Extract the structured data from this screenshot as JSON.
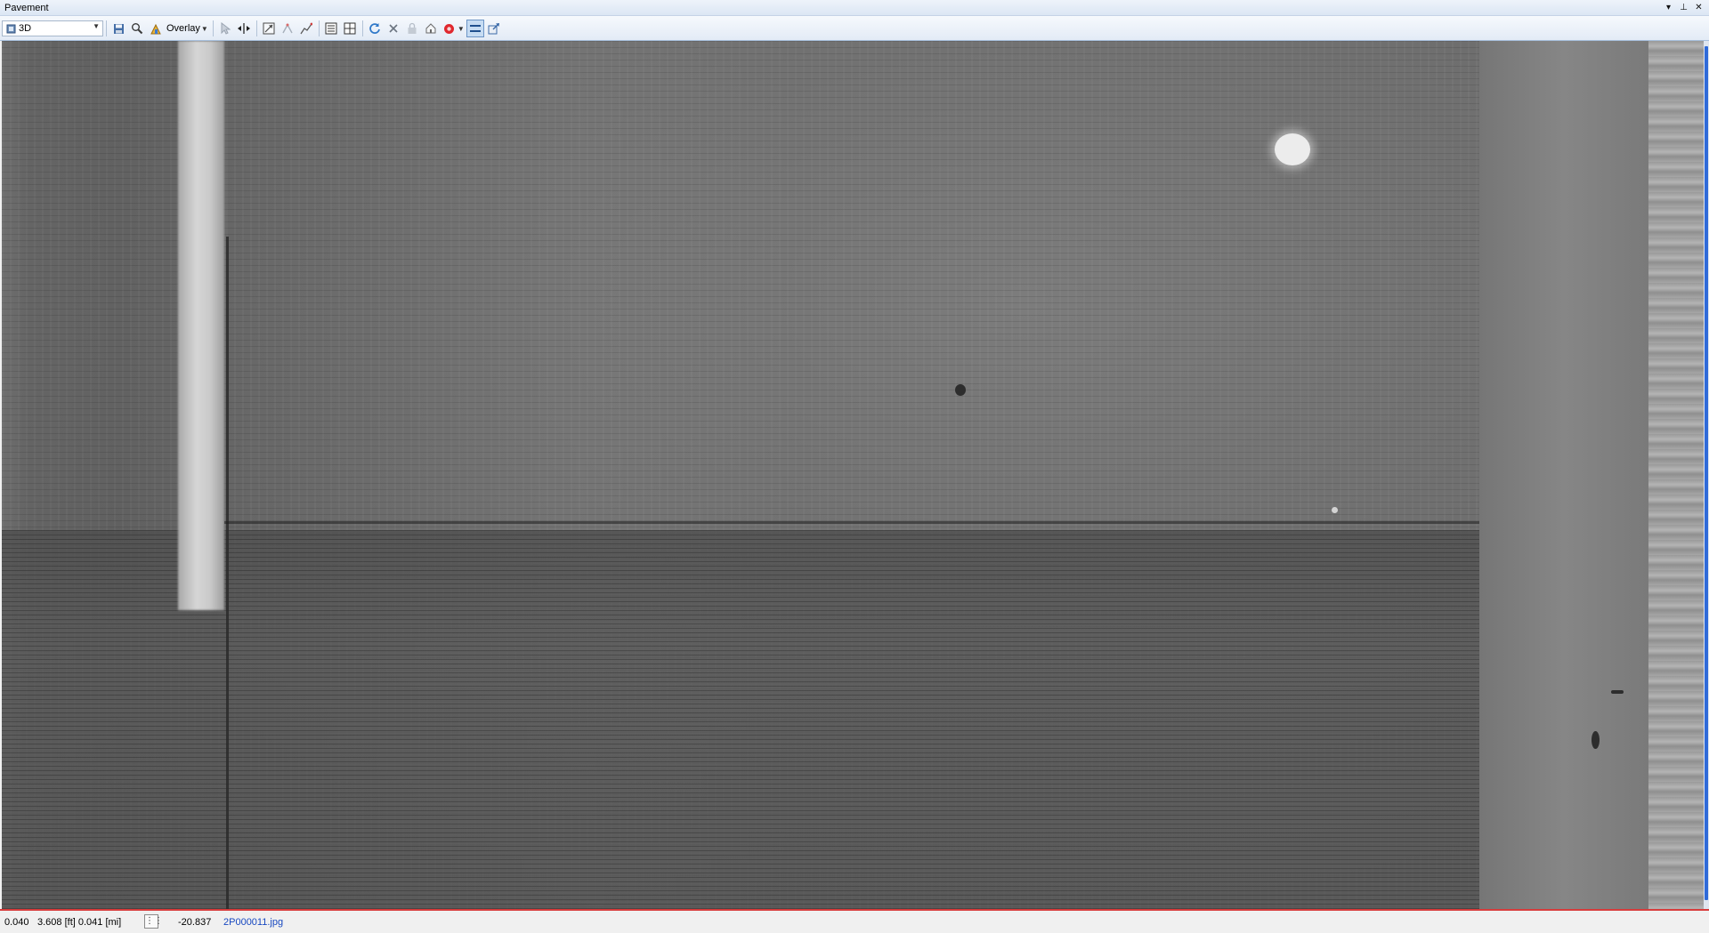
{
  "window": {
    "title": "Pavement",
    "buttons": {
      "pin": "▾",
      "autohide": "⊥",
      "close": "✕"
    }
  },
  "toolbar": {
    "view_mode": {
      "selected": "3D"
    },
    "overlay": {
      "label": "Overlay"
    },
    "icons": [
      "view-mode-icon",
      "save-icon",
      "zoom-icon",
      "overlay-paint-icon",
      "pointer-icon",
      "pan-horizontal-icon",
      "fit-view-icon",
      "measure-icon",
      "polyline-icon",
      "layout-single-icon",
      "layout-split-icon",
      "refresh-icon",
      "delete-icon",
      "lock-icon",
      "home-icon",
      "record-icon",
      "stripe-icon",
      "export-icon"
    ]
  },
  "status": {
    "chainage": "0.040",
    "distance": "3.608 [ft] 0.041 [mi]",
    "value": "-20.837",
    "file": "2P000011.jpg"
  },
  "colors": {
    "toolbar_bg": "#e3ebf6",
    "status_border": "#d83c3c",
    "file_link": "#1848c0",
    "scroll_thumb": "#2f6ad8"
  }
}
